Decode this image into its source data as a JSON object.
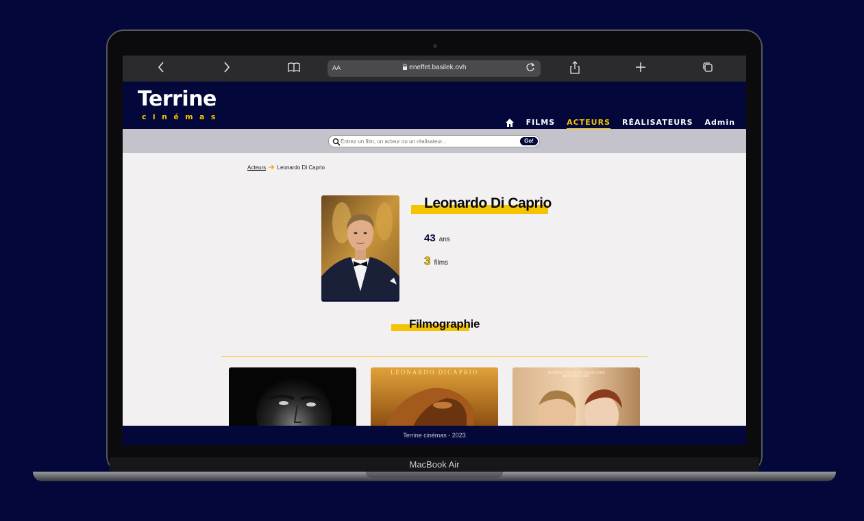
{
  "device": {
    "label": "MacBook Air"
  },
  "browser": {
    "url": "eneffet.basilek.ovh",
    "text_size_label": "AA",
    "icons": [
      "chevron-left-icon",
      "chevron-right-icon",
      "book-icon",
      "lock-icon",
      "reload-icon",
      "share-icon",
      "plus-icon",
      "tabs-icon"
    ]
  },
  "site": {
    "logo_main": "Terrine",
    "logo_sub": "cinémas",
    "nav": {
      "home_icon": "home-icon",
      "films": "FILMS",
      "acteurs": "ACTEURS",
      "realisateurs": "RÉALISATEURS",
      "admin": "Admin",
      "active": "ACTEURS"
    },
    "search": {
      "placeholder": "Entrez un film, un acteur ou un réalisateur...",
      "button": "Go!"
    },
    "colors": {
      "navy": "#03073a",
      "accent": "#f5c400",
      "page_bg": "#f2f0f0"
    }
  },
  "breadcrumb": {
    "parent": "Acteurs",
    "current": "Leonardo Di Caprio"
  },
  "actor": {
    "name": "Leonardo Di Caprio",
    "age_value": "43",
    "age_unit": "ans",
    "films_value": "3",
    "films_unit": "films"
  },
  "filmography": {
    "title": "Filmographie",
    "posters": [
      {
        "text": ""
      },
      {
        "text": "LEONARDO DICAPRIO"
      },
      {
        "text": "NOTHING ON EARTH COULD COME BETWEEN THEM"
      }
    ]
  },
  "footer": {
    "text": "Terrine cinémas - 2023"
  }
}
